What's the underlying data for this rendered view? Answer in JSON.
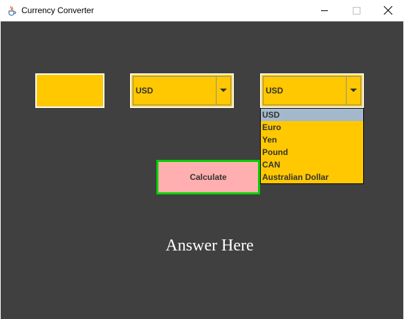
{
  "window": {
    "title": "Currency Converter",
    "icon": "java-cup-icon"
  },
  "amount": {
    "value": ""
  },
  "from_currency": {
    "selected": "USD"
  },
  "to_currency": {
    "selected": "USD",
    "expanded": true,
    "options": [
      "USD",
      "Euro",
      "Yen",
      "Pound",
      "CAN",
      "Australian Dollar"
    ],
    "highlighted_index": 0
  },
  "calculate": {
    "label": "Calculate"
  },
  "result": {
    "text": "Answer Here"
  },
  "colors": {
    "background": "#404040",
    "field": "#ffc800",
    "button": "#ffafaf",
    "button_border": "#00d000",
    "highlight": "#a3b8cc"
  }
}
